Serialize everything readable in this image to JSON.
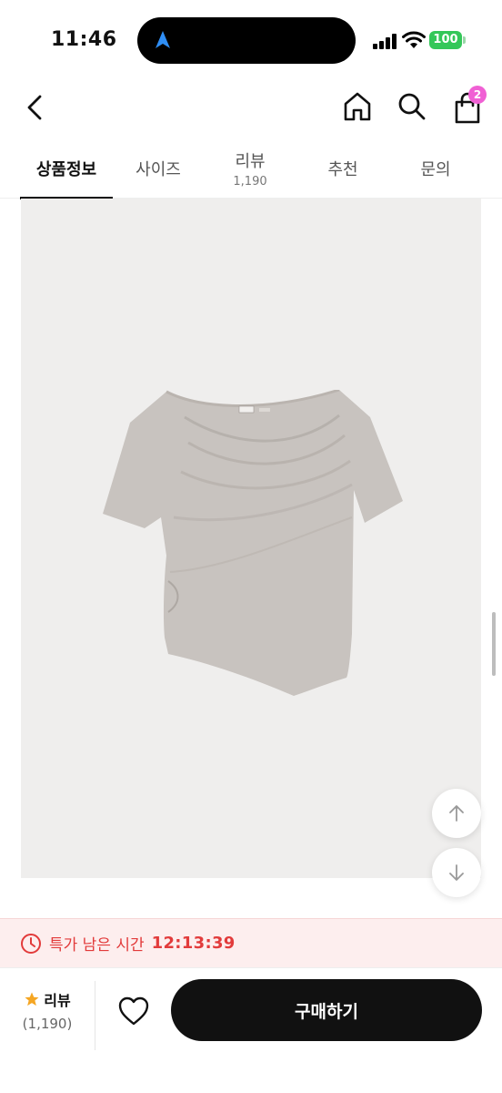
{
  "status_bar": {
    "time": "11:46",
    "battery": "100",
    "icons": [
      "navigation-arrow-icon",
      "signal-icon",
      "wifi-icon",
      "battery-icon"
    ]
  },
  "header": {
    "icons": [
      "back-icon",
      "home-icon",
      "search-icon",
      "cart-icon"
    ],
    "cart_badge": "2"
  },
  "tabs": [
    {
      "label": "상품정보",
      "sub": "",
      "active": true
    },
    {
      "label": "사이즈",
      "sub": "",
      "active": false
    },
    {
      "label": "리뷰",
      "sub": "1,190",
      "active": false
    },
    {
      "label": "추천",
      "sub": "",
      "active": false
    },
    {
      "label": "문의",
      "sub": "",
      "active": false
    }
  ],
  "floating_buttons": [
    "arrow-up-icon",
    "arrow-down-icon"
  ],
  "timer": {
    "label": "특가 남은 시간",
    "value": "12:13:39",
    "icon": "clock-icon"
  },
  "bottom_bar": {
    "review_label": "리뷰",
    "review_count": "(1,190)",
    "icons": [
      "star-icon",
      "heart-icon"
    ],
    "buy_label": "구매하기"
  },
  "colors": {
    "accent_red": "#e23b3b",
    "badge_pink": "#f060d4",
    "battery_green": "#34c759",
    "buy_button": "#111111",
    "star": "#f5a623"
  }
}
